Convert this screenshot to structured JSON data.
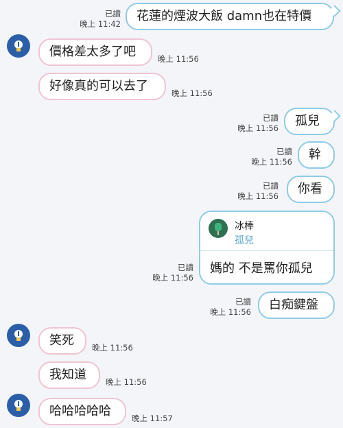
{
  "messages": [
    {
      "text": "花蓮的煙波大飯 damn也在特價",
      "read": "已讀",
      "time": "晚上 11:42"
    },
    {
      "text": "價格差太多了吧",
      "time": "晚上 11:56"
    },
    {
      "text": "好像真的可以去了",
      "time": "晚上 11:56"
    },
    {
      "text": "孤兒",
      "read": "已讀",
      "time": "晚上 11:56"
    },
    {
      "text": "幹",
      "read": "已讀",
      "time": "晚上 11:56"
    },
    {
      "text": "你看",
      "read": "已讀",
      "time": "晚上 11:56"
    },
    {
      "reply_name": "冰棒",
      "reply_quote": "孤兒",
      "text": "媽的 不是罵你孤兒",
      "read": "已讀",
      "time": "晚上 11:56"
    },
    {
      "text": "白痴鍵盤",
      "read": "已讀",
      "time": "晚上 11:56"
    },
    {
      "text": "笑死",
      "time": "晚上 11:56"
    },
    {
      "text": "我知道",
      "time": "晚上 11:56"
    },
    {
      "text": "哈哈哈哈哈",
      "time": "晚上 11:57"
    }
  ],
  "colors": {
    "outgoing_border": "#8fcbe6",
    "incoming_border": "#f0c4d3",
    "avatar": "#2a5ea8",
    "reply_quote": "#5aa6cc"
  },
  "icons": {
    "avatar": "lightbulb-icon",
    "reply_thumb": "ice-pop-avatar-icon"
  }
}
